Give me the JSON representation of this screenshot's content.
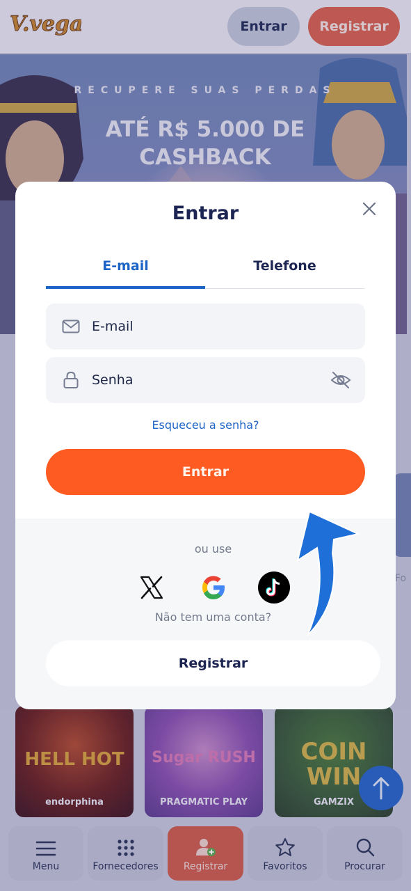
{
  "header": {
    "logo_text": "V.vegas",
    "login_label": "Entrar",
    "register_label": "Registrar"
  },
  "banner": {
    "subtitle": "RECUPERE SUAS PERDAS",
    "headline": "ATÉ R$ 5.000 DE CASHBACK"
  },
  "games": [
    {
      "title": "HELL HOT",
      "provider": "endorphina"
    },
    {
      "title": "Sugar RUSH",
      "provider": "PRAGMATIC PLAY"
    },
    {
      "title": "COIN WIN",
      "provider": "GAMZIX"
    }
  ],
  "side_peek_label": "Fo",
  "modal": {
    "title": "Entrar",
    "tabs": [
      {
        "label": "E-mail",
        "active": true
      },
      {
        "label": "Telefone",
        "active": false
      }
    ],
    "email_placeholder": "E-mail",
    "password_placeholder": "Senha",
    "forgot_label": "Esqueceu a senha?",
    "submit_label": "Entrar",
    "or_use_label": "ou use",
    "social": [
      "x-icon",
      "google-icon",
      "tiktok-icon"
    ],
    "no_account_label": "Não tem uma conta?",
    "register_label": "Registrar"
  },
  "bottom_nav": [
    {
      "label": "Menu",
      "icon": "menu-icon"
    },
    {
      "label": "Fornecedores",
      "icon": "grid-icon"
    },
    {
      "label": "Registrar",
      "icon": "add-user-icon",
      "active": true
    },
    {
      "label": "Favoritos",
      "icon": "star-icon"
    },
    {
      "label": "Procurar",
      "icon": "search-icon"
    }
  ],
  "colors": {
    "accent_orange": "#fe5b23",
    "accent_blue": "#1c64c6",
    "text_dark": "#1d2552"
  }
}
